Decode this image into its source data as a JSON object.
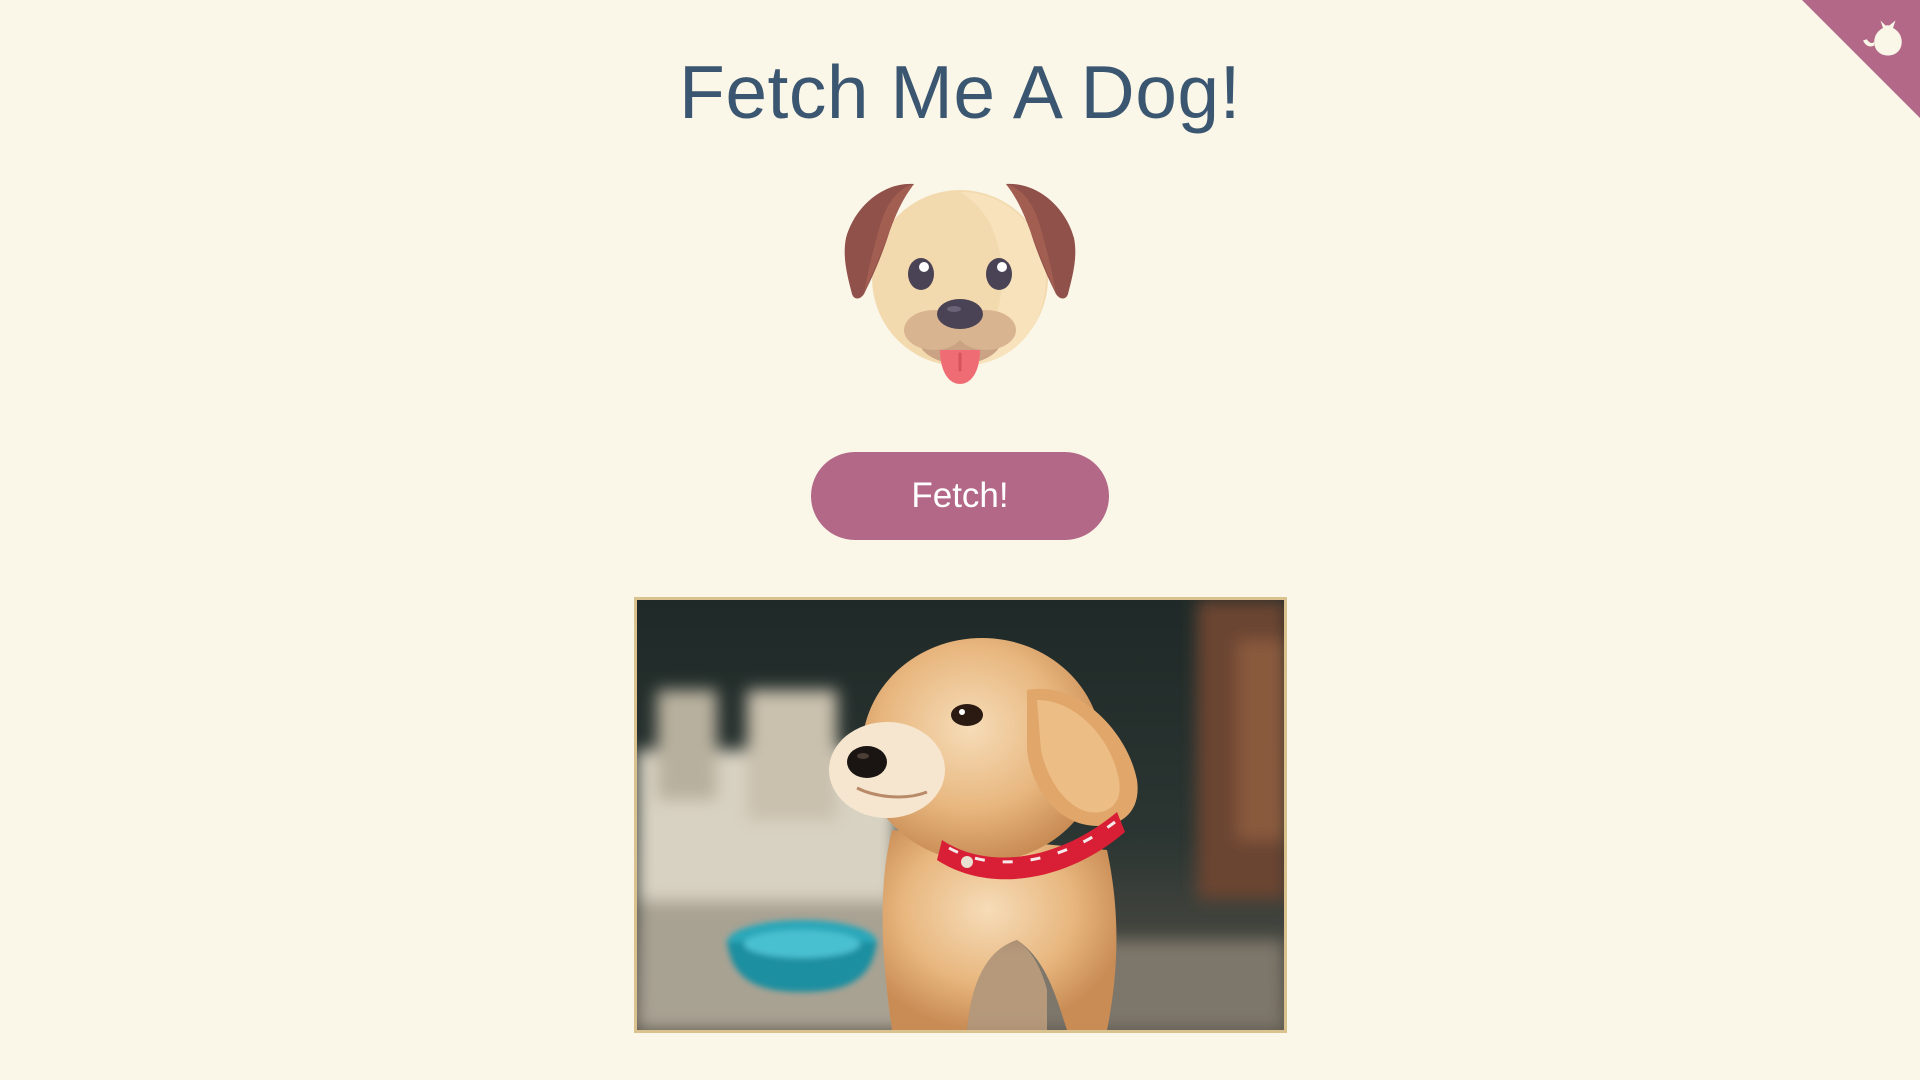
{
  "header": {
    "title": "Fetch Me A Dog!"
  },
  "logo": {
    "icon": "dog-face-icon"
  },
  "actions": {
    "fetch_label": "Fetch!"
  },
  "corner": {
    "icon": "github-octocat-icon"
  },
  "photo": {
    "subject": "dog-photo"
  },
  "colors": {
    "background": "#faf6e8",
    "title": "#3b5670",
    "accent": "#b36888",
    "frame": "#d9c28e"
  }
}
